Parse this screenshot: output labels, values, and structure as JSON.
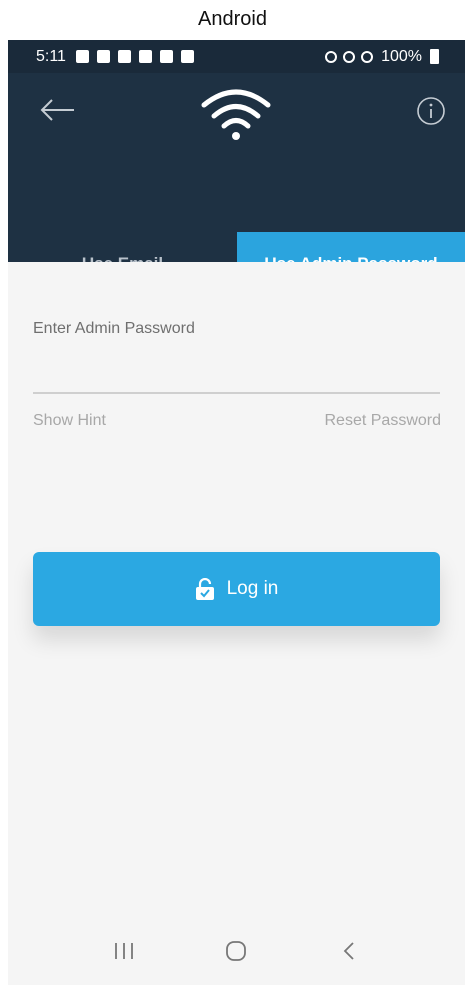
{
  "caption": "Android",
  "status_bar": {
    "time": "5:11",
    "battery": "100%"
  },
  "header": {
    "icons": [
      "back-arrow-icon",
      "wifi-icon",
      "info-icon"
    ]
  },
  "tabs": [
    {
      "label": "Use Email",
      "active": false
    },
    {
      "label": "Use Admin Password",
      "active": true
    }
  ],
  "form": {
    "password_label": "Enter Admin Password",
    "password_value": "",
    "show_hint": "Show Hint",
    "reset_password": "Reset Password"
  },
  "login_button": {
    "label": "Log in",
    "icon": "lock-icon"
  },
  "colors": {
    "header_bg": "#1e3143",
    "accent": "#2ba8e2",
    "background": "#f5f5f5"
  },
  "nav_bar": {
    "icons": [
      "recents-icon",
      "home-icon",
      "back-icon"
    ]
  }
}
